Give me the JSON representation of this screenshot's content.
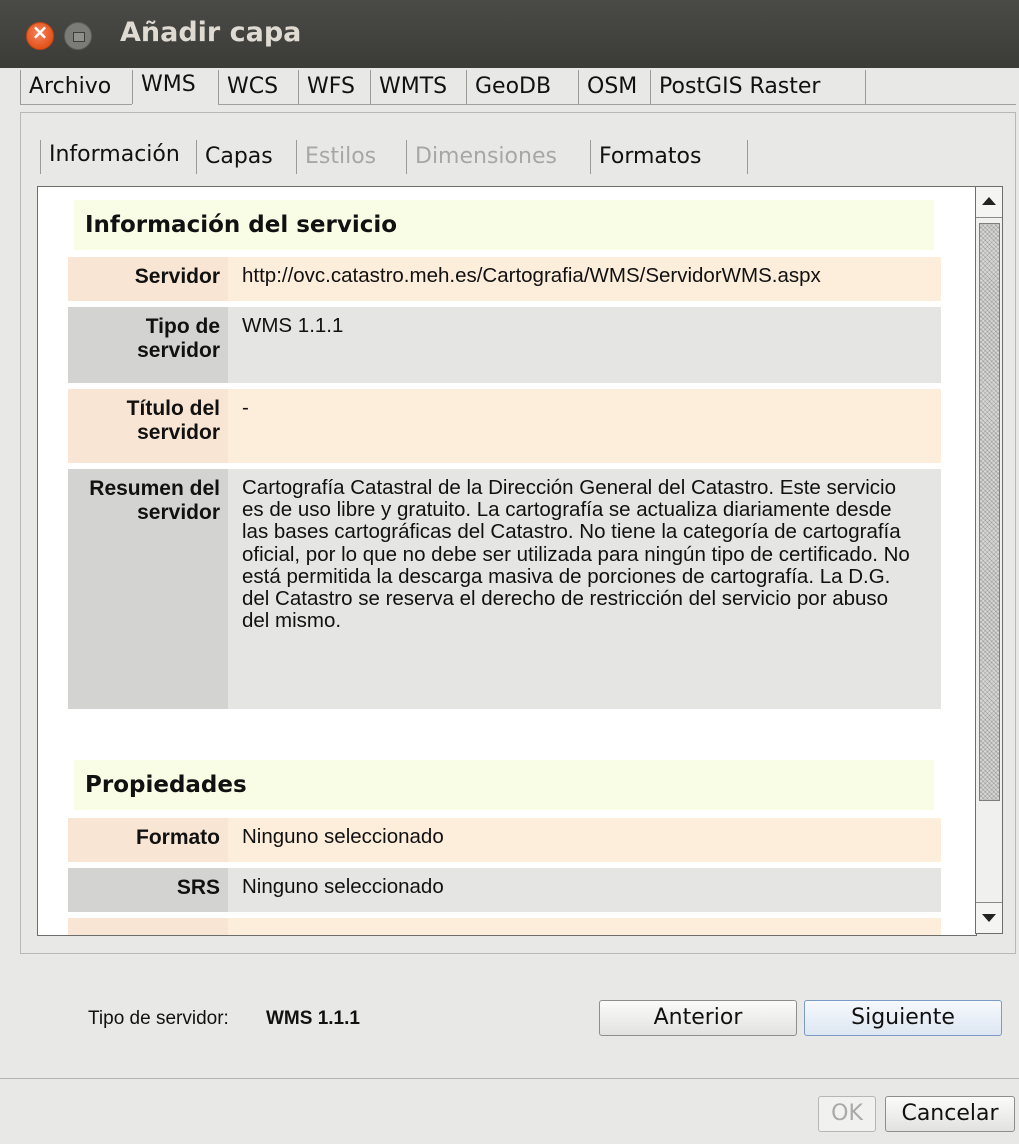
{
  "window": {
    "title": "Añadir capa"
  },
  "main_tabs": [
    "Archivo",
    "WMS",
    "WCS",
    "WFS",
    "WMTS",
    "GeoDB",
    "OSM",
    "PostGIS Raster"
  ],
  "sub_tabs": [
    "Información",
    "Capas",
    "Estilos",
    "Dimensiones",
    "Formatos"
  ],
  "service_section": {
    "title": "Información del servicio",
    "rows": [
      {
        "label": "Servidor",
        "value": "http://ovc.catastro.meh.es/Cartografia/WMS/ServidorWMS.aspx"
      },
      {
        "label": "Tipo de servidor",
        "value": "WMS 1.1.1"
      },
      {
        "label": "Título del servidor",
        "value": "-"
      },
      {
        "label": "Resumen del servidor",
        "value": "Cartografía Catastral de la Dirección General del Catastro. Este servicio es de uso libre y gratuito. La cartografía se actualiza diariamente desde las bases cartográficas del Catastro. No tiene la categoría de cartografía oficial, por lo que no debe ser utilizada para ningún tipo de certificado. No está permitida la descarga masiva de porciones de cartografía. La D.G. del Catastro se reserva el derecho de restricción del servicio por abuso del mismo."
      }
    ]
  },
  "properties_section": {
    "title": "Propiedades",
    "rows": [
      {
        "label": "Formato",
        "value": "Ninguno seleccionado"
      },
      {
        "label": "SRS",
        "value": "Ninguno seleccionado"
      }
    ]
  },
  "status": {
    "label": "Tipo de servidor:",
    "value": "WMS 1.1.1"
  },
  "buttons": {
    "previous": "Anterior",
    "next": "Siguiente",
    "ok": "OK",
    "cancel": "Cancelar"
  }
}
